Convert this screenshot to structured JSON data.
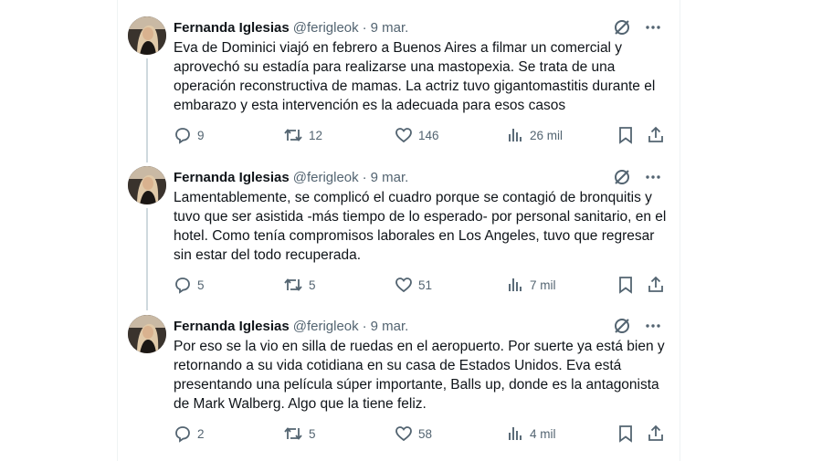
{
  "tweets": [
    {
      "author_name": "Fernanda Iglesias",
      "handle": "@ferigleok",
      "separator": "·",
      "date": "9 mar.",
      "text": "Eva de Dominici viajó en febrero a Buenos Aires a filmar un comercial y aprovechó su estadía para realizarse una mastopexia. Se trata de una operación reconstructiva de mamas. La actriz tuvo gigantomastitis durante el embarazo y esta intervención es la adecuada para esos casos",
      "replies": "9",
      "retweets": "12",
      "likes": "146",
      "views": "26 mil"
    },
    {
      "author_name": "Fernanda Iglesias",
      "handle": "@ferigleok",
      "separator": "·",
      "date": "9 mar.",
      "text": "Lamentablemente, se complicó el cuadro porque se contagió de bronquitis y tuvo que ser asistida -más tiempo de lo esperado- por personal sanitario, en el hotel. Como tenía compromisos laborales en Los Angeles, tuvo que regresar sin estar del todo recuperada.",
      "replies": "5",
      "retweets": "5",
      "likes": "51",
      "views": "7 mil"
    },
    {
      "author_name": "Fernanda Iglesias",
      "handle": "@ferigleok",
      "separator": "·",
      "date": "9 mar.",
      "text": "Por eso se la vio en silla de ruedas en el aeropuerto. Por suerte ya está bien y retornando a su vida cotidiana en su casa de Estados Unidos. Eva está presentando una película súper importante, Balls up, donde es la antagonista de Mark Walberg. Algo que la tiene feliz.",
      "replies": "2",
      "retweets": "5",
      "likes": "58",
      "views": "4 mil"
    }
  ],
  "icons": {
    "grok": "grok-icon",
    "more": "more-icon",
    "reply": "reply-icon",
    "retweet": "retweet-icon",
    "like": "like-icon",
    "views": "views-icon",
    "bookmark": "bookmark-icon",
    "share": "share-icon"
  },
  "colors": {
    "text": "#0f1419",
    "muted": "#536471",
    "thread_line": "#cfd9de"
  }
}
